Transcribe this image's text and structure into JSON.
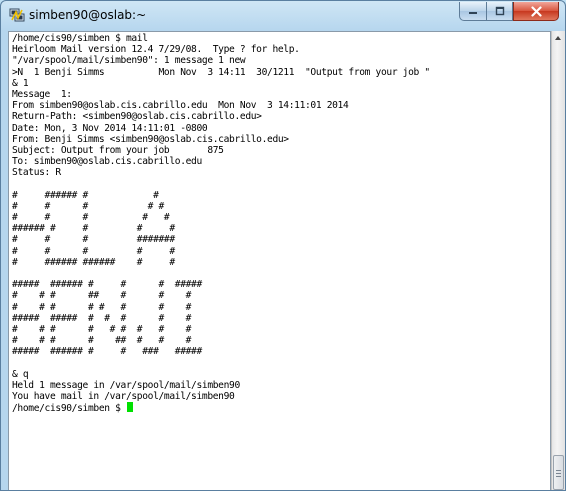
{
  "window": {
    "title": "simben90@oslab:~",
    "app_icon": "putty-icon",
    "buttons": {
      "minimize": "minimize-icon",
      "maximize": "maximize-icon",
      "close": "close-icon"
    }
  },
  "terminal": {
    "lines": [
      "/home/cis90/simben $ mail",
      "Heirloom Mail version 12.4 7/29/08.  Type ? for help.",
      "\"/var/spool/mail/simben90\": 1 message 1 new",
      ">N  1 Benji Simms          Mon Nov  3 14:11  30/1211  \"Output from your job \"",
      "& 1",
      "Message  1:",
      "From simben90@oslab.cis.cabrillo.edu  Mon Nov  3 14:11:01 2014",
      "Return-Path: <simben90@oslab.cis.cabrillo.edu>",
      "Date: Mon, 3 Nov 2014 14:11:01 -0800",
      "From: Benji Simms <simben90@oslab.cis.cabrillo.edu>",
      "Subject: Output from your job       875",
      "To: simben90@oslab.cis.cabrillo.edu",
      "Status: R",
      "",
      "#     ###### #            #",
      "#     #      #           # #",
      "#     #      #          #   #",
      "###### #     #         #     #",
      "#     #      #         #######",
      "#     #      #         #     #",
      "#     ###### ######    #     #",
      "",
      "#####  ###### #     #      #  #####",
      "#    # #      ##    #      #    #",
      "#    # #      # #   #      #    #",
      "#####  #####  #  #  #      #    #",
      "#    # #      #   # #  #   #    #",
      "#    # #      #    ##  #   #    #",
      "#####  ###### #     #   ###   #####",
      "",
      "& q",
      "Held 1 message in /var/spool/mail/simben90",
      "You have mail in /var/spool/mail/simben90",
      "/home/cis90/simben $ "
    ],
    "cursor_color": "#00e000"
  },
  "colors": {
    "terminal_background": "#ffffff",
    "terminal_text": "#000000",
    "window_frame": "#b6d6ee",
    "close_button": "#c7381f"
  }
}
